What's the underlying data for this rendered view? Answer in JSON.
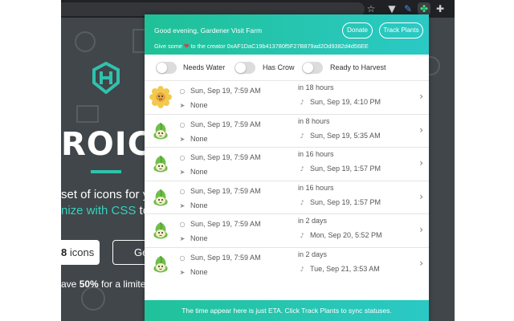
{
  "browser": {
    "icons": [
      "star-icon",
      "extension-v-icon",
      "extension-pen-icon",
      "extension-clover-icon",
      "puzzle-icon",
      "menu-icon"
    ]
  },
  "website": {
    "title": "ROICO",
    "line1": "set of icons for yo",
    "line2_accent": "nize with CSS",
    "line2_rest": " to be",
    "button1_count": "8",
    "button1_rest": " icons",
    "button2": "Ge",
    "line3_pre": "ave ",
    "line3_bold": "50%",
    "line3_post": " for a limited t"
  },
  "popup": {
    "greeting": "Good evening, Gardener Visit Farm",
    "give_prefix": "Give some",
    "give_suffix": "to the creator 0xAF1DaC19b413780f5F27B879ad2Od9382d4d56EE",
    "donate_label": "Donate",
    "track_label": "Track Plants",
    "filters": [
      {
        "label": "Needs Water",
        "on": false
      },
      {
        "label": "Has Crow",
        "on": false
      },
      {
        "label": "Ready to Harvest",
        "on": false
      }
    ],
    "rows": [
      {
        "plant": "sunflower",
        "watered": "Sun, Sep 19, 7:59 AM",
        "crow": "None",
        "eta": "in 18 hours",
        "harvest": "Sun, Sep 19, 4:10 PM"
      },
      {
        "plant": "sprout",
        "watered": "Sun, Sep 19, 7:59 AM",
        "crow": "None",
        "eta": "in 8 hours",
        "harvest": "Sun, Sep 19, 5:35 AM"
      },
      {
        "plant": "sprout",
        "watered": "Sun, Sep 19, 7:59 AM",
        "crow": "None",
        "eta": "in 16 hours",
        "harvest": "Sun, Sep 19, 1:57 PM"
      },
      {
        "plant": "sprout",
        "watered": "Sun, Sep 19, 7:59 AM",
        "crow": "None",
        "eta": "in 16 hours",
        "harvest": "Sun, Sep 19, 1:57 PM"
      },
      {
        "plant": "sprout",
        "watered": "Sun, Sep 19, 7:59 AM",
        "crow": "None",
        "eta": "in 2 days",
        "harvest": "Mon, Sep 20, 5:52 PM"
      },
      {
        "plant": "sprout",
        "watered": "Sun, Sep 19, 7:59 AM",
        "crow": "None",
        "eta": "in 2 days",
        "harvest": "Tue, Sep 21, 3:53 AM"
      }
    ],
    "footer": "The time appear here is just ETA. Click Track Plants to sync statuses.",
    "colors": {
      "accent_start": "#1fc197",
      "accent_end": "#2bc9c5",
      "heart": "#e8334a"
    }
  }
}
